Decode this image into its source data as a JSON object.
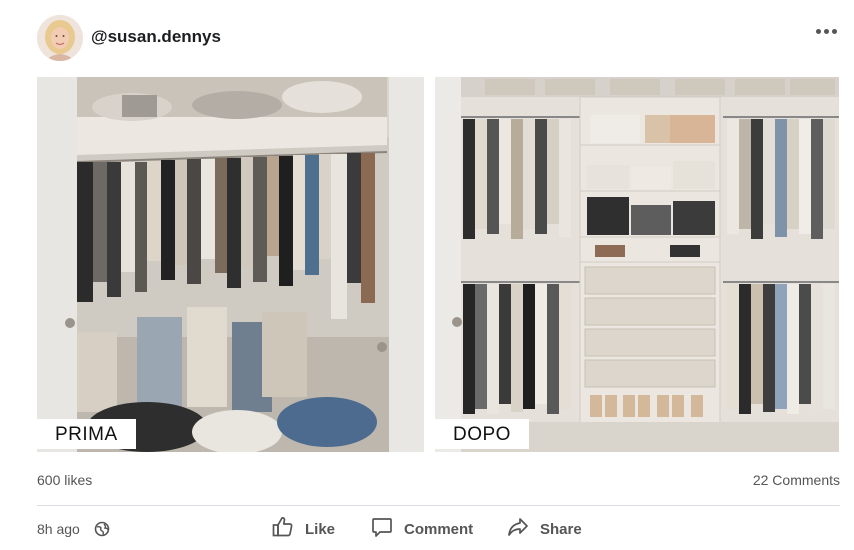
{
  "post": {
    "author": {
      "username": "@susan.dennys",
      "avatar_icon": "profile-photo"
    },
    "more_icon": "ellipsis-icon",
    "images": [
      {
        "label": "PRIMA",
        "subject": "messy-closet"
      },
      {
        "label": "DOPO",
        "subject": "organized-closet"
      }
    ],
    "stats": {
      "likes": "600 likes",
      "comments": "22 Comments"
    },
    "footer": {
      "time": "8h ago",
      "privacy_icon": "globe-icon",
      "like_label": "Like",
      "comment_label": "Comment",
      "share_label": "Share"
    }
  },
  "colors": {
    "text": "#1c1e21",
    "muted": "#555555",
    "divider": "#dadde1"
  }
}
